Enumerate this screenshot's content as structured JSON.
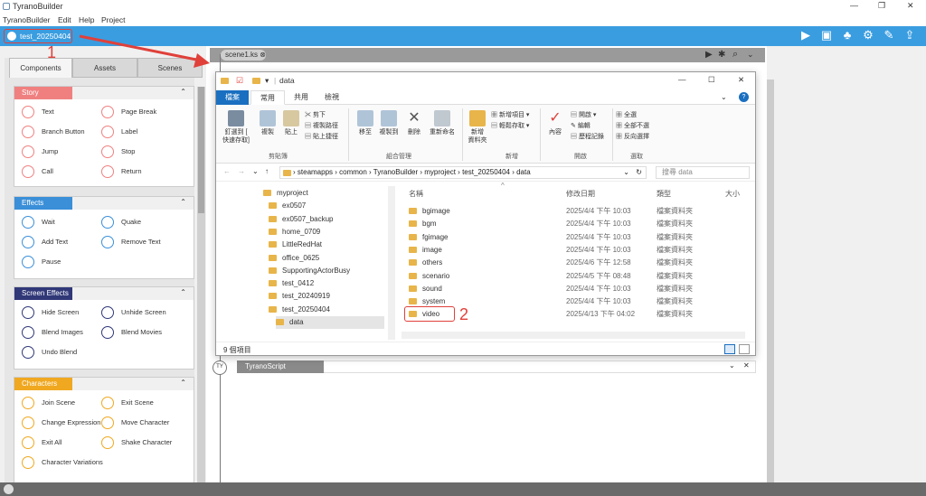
{
  "app": {
    "title": "TyranoBuilder",
    "menu": [
      "TyranoBuilder",
      "Edit",
      "Help",
      "Project"
    ]
  },
  "project_tab": "test_20250404",
  "annotations": {
    "one": "1",
    "two": "2"
  },
  "left_tabs": [
    "Components",
    "Assets",
    "Scenes"
  ],
  "sections": [
    {
      "title": "Story",
      "color": "#f08080",
      "items": [
        [
          "Text",
          "Page Break"
        ],
        [
          "Branch Button",
          "Label"
        ],
        [
          "Jump",
          "Stop"
        ],
        [
          "Call",
          "Return"
        ]
      ]
    },
    {
      "title": "Effects",
      "color": "#3a8fd8",
      "items": [
        [
          "Wait",
          "Quake"
        ],
        [
          "Add Text",
          "Remove Text"
        ],
        [
          "Pause",
          ""
        ]
      ]
    },
    {
      "title": "Screen Effects",
      "color": "#303878",
      "items": [
        [
          "Hide Screen",
          "Unhide Screen"
        ],
        [
          "Blend Images",
          "Blend Movies"
        ],
        [
          "Undo Blend",
          ""
        ]
      ]
    },
    {
      "title": "Characters",
      "color": "#f0a820",
      "items": [
        [
          "Join Scene",
          "Exit Scene"
        ],
        [
          "Change Expression",
          "Move Character"
        ],
        [
          "Exit All",
          "Shake Character"
        ],
        [
          "Character Variations",
          ""
        ]
      ]
    }
  ],
  "scene_tab": "scene1.ks",
  "tyranoscript_label": "TyranoScript",
  "tyranoscript_icon": "TY",
  "explorer": {
    "title": "data",
    "ribbon_tabs": [
      "檔案",
      "常用",
      "共用",
      "檢視"
    ],
    "ribbon": {
      "pin": "釘選到 [\n快速存取]",
      "copy": "複製",
      "paste": "貼上",
      "cut": "剪下",
      "copy_path": "複製路徑",
      "paste_shortcut": "貼上捷徑",
      "move": "移至",
      "copy_to": "複製到",
      "delete": "刪除",
      "rename": "重新命名",
      "new_folder": "新增\n資料夾",
      "new_item": "新增項目",
      "easy_access": "輕鬆存取",
      "properties": "內容",
      "open": "開啟",
      "edit": "編輯",
      "history": "歷程記錄",
      "select_all": "全選",
      "select_none": "全部不選",
      "invert": "反向選擇",
      "groups": [
        "剪貼簿",
        "組合管理",
        "新增",
        "開啟",
        "選取"
      ]
    },
    "breadcrumb": [
      "steamapps",
      "common",
      "TyranoBuilder",
      "myproject",
      "test_20250404",
      "data"
    ],
    "search_placeholder": "搜尋 data",
    "nav": [
      "myproject",
      "ex0507",
      "ex0507_backup",
      "home_0709",
      "LittleRedHat",
      "office_0625",
      "SupportingActorBusy",
      "test_0412",
      "test_20240919",
      "test_20250404",
      "data"
    ],
    "columns": [
      "名稱",
      "修改日期",
      "類型",
      "大小"
    ],
    "files": [
      {
        "name": "bgimage",
        "date": "2025/4/4 下午 10:03",
        "type": "檔案資料夾"
      },
      {
        "name": "bgm",
        "date": "2025/4/4 下午 10:03",
        "type": "檔案資料夾"
      },
      {
        "name": "fgimage",
        "date": "2025/4/4 下午 10:03",
        "type": "檔案資料夾"
      },
      {
        "name": "image",
        "date": "2025/4/4 下午 10:03",
        "type": "檔案資料夾"
      },
      {
        "name": "others",
        "date": "2025/4/6 下午 12:58",
        "type": "檔案資料夾"
      },
      {
        "name": "scenario",
        "date": "2025/4/5 下午 08:48",
        "type": "檔案資料夾"
      },
      {
        "name": "sound",
        "date": "2025/4/4 下午 10:03",
        "type": "檔案資料夾"
      },
      {
        "name": "system",
        "date": "2025/4/4 下午 10:03",
        "type": "檔案資料夾"
      },
      {
        "name": "video",
        "date": "2025/4/13 下午 04:02",
        "type": "檔案資料夾"
      }
    ],
    "status": "9 個項目"
  }
}
